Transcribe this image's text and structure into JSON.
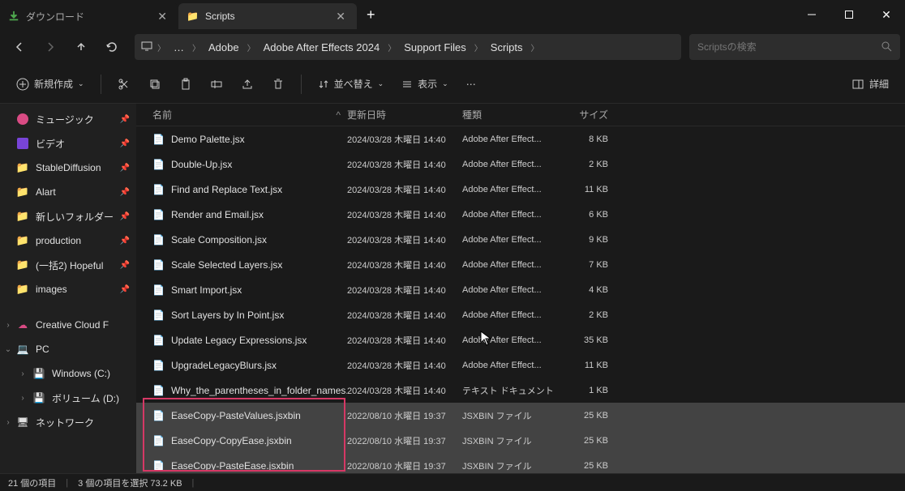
{
  "tabs": [
    {
      "label": "ダウンロード",
      "icon": "download",
      "active": false
    },
    {
      "label": "Scripts",
      "icon": "folder",
      "active": true
    }
  ],
  "breadcrumbs": {
    "ellipsis": "…",
    "items": [
      "Adobe",
      "Adobe After Effects 2024",
      "Support Files",
      "Scripts"
    ]
  },
  "search": {
    "placeholder": "Scriptsの検索"
  },
  "toolbar": {
    "new_label": "新規作成",
    "sort_label": "並べ替え",
    "view_label": "表示",
    "details_label": "詳細"
  },
  "sidebar": {
    "items": [
      {
        "label": "ミュージック",
        "icon": "music",
        "pin": true
      },
      {
        "label": "ビデオ",
        "icon": "video",
        "pin": true
      },
      {
        "label": "StableDiffusion",
        "icon": "folder",
        "pin": true
      },
      {
        "label": "Alart",
        "icon": "folder",
        "pin": true
      },
      {
        "label": "新しいフォルダー",
        "icon": "folder",
        "pin": true
      },
      {
        "label": "production",
        "icon": "folder",
        "pin": true
      },
      {
        "label": "(一括2) Hopeful",
        "icon": "folder",
        "pin": true
      },
      {
        "label": "images",
        "icon": "folder",
        "pin": true
      }
    ],
    "groups": [
      {
        "label": "Creative Cloud F",
        "icon": "cloud",
        "expand": "›"
      },
      {
        "label": "PC",
        "icon": "pc",
        "expand": "⌄",
        "children": [
          {
            "label": "Windows (C:)",
            "icon": "drive",
            "expand": "›"
          },
          {
            "label": "ボリューム (D:)",
            "icon": "drive",
            "expand": "›"
          }
        ]
      },
      {
        "label": "ネットワーク",
        "icon": "net",
        "expand": "›"
      }
    ]
  },
  "columns": {
    "name": "名前",
    "date": "更新日時",
    "type": "種類",
    "size": "サイズ"
  },
  "files": [
    {
      "name": "Demo Palette.jsx",
      "date": "2024/03/28 木曜日 14:40",
      "type": "Adobe After Effect...",
      "size": "8 KB",
      "sel": false
    },
    {
      "name": "Double-Up.jsx",
      "date": "2024/03/28 木曜日 14:40",
      "type": "Adobe After Effect...",
      "size": "2 KB",
      "sel": false
    },
    {
      "name": "Find and Replace Text.jsx",
      "date": "2024/03/28 木曜日 14:40",
      "type": "Adobe After Effect...",
      "size": "11 KB",
      "sel": false
    },
    {
      "name": "Render and Email.jsx",
      "date": "2024/03/28 木曜日 14:40",
      "type": "Adobe After Effect...",
      "size": "6 KB",
      "sel": false
    },
    {
      "name": "Scale Composition.jsx",
      "date": "2024/03/28 木曜日 14:40",
      "type": "Adobe After Effect...",
      "size": "9 KB",
      "sel": false
    },
    {
      "name": "Scale Selected Layers.jsx",
      "date": "2024/03/28 木曜日 14:40",
      "type": "Adobe After Effect...",
      "size": "7 KB",
      "sel": false
    },
    {
      "name": "Smart Import.jsx",
      "date": "2024/03/28 木曜日 14:40",
      "type": "Adobe After Effect...",
      "size": "4 KB",
      "sel": false
    },
    {
      "name": "Sort Layers by In Point.jsx",
      "date": "2024/03/28 木曜日 14:40",
      "type": "Adobe After Effect...",
      "size": "2 KB",
      "sel": false
    },
    {
      "name": "Update Legacy Expressions.jsx",
      "date": "2024/03/28 木曜日 14:40",
      "type": "Adobe After Effect...",
      "size": "35 KB",
      "sel": false
    },
    {
      "name": "UpgradeLegacyBlurs.jsx",
      "date": "2024/03/28 木曜日 14:40",
      "type": "Adobe After Effect...",
      "size": "11 KB",
      "sel": false
    },
    {
      "name": "Why_the_parentheses_in_folder_names.txt",
      "date": "2024/03/28 木曜日 14:40",
      "type": "テキスト ドキュメント",
      "size": "1 KB",
      "sel": false,
      "txt": true
    },
    {
      "name": "EaseCopy-PasteValues.jsxbin",
      "date": "2022/08/10 水曜日 19:37",
      "type": "JSXBIN ファイル",
      "size": "25 KB",
      "sel": true
    },
    {
      "name": "EaseCopy-CopyEase.jsxbin",
      "date": "2022/08/10 水曜日 19:37",
      "type": "JSXBIN ファイル",
      "size": "25 KB",
      "sel": true
    },
    {
      "name": "EaseCopy-PasteEase.jsxbin",
      "date": "2022/08/10 水曜日 19:37",
      "type": "JSXBIN ファイル",
      "size": "25 KB",
      "sel": true
    }
  ],
  "status": {
    "item_count": "21 個の項目",
    "selection": "3 個の項目を選択 73.2 KB"
  }
}
